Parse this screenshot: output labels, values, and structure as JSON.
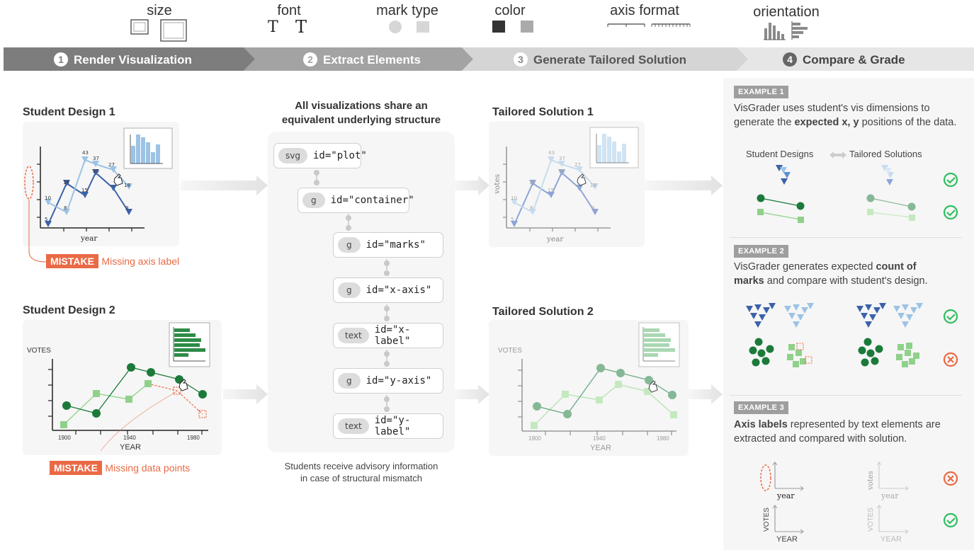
{
  "dimensions": {
    "size": "size",
    "font": "font",
    "font_glyph": "T",
    "mark_type": "mark type",
    "color": "color",
    "axis_format": "axis format",
    "orientation": "orientation"
  },
  "steps": [
    {
      "num": "1",
      "label": "Render Visualization"
    },
    {
      "num": "2",
      "label": "Extract Elements"
    },
    {
      "num": "3",
      "label": "Generate Tailored Solution"
    },
    {
      "num": "4",
      "label": "Compare & Grade"
    }
  ],
  "student1": {
    "title": "Student Design 1",
    "xlabel": "year",
    "data_labels": [
      "5",
      "10",
      "8",
      "19",
      "15",
      "43",
      "37",
      "25",
      "27",
      "18",
      "9"
    ],
    "mistake_tag": "MISTAKE",
    "mistake_text": "Missing axis label"
  },
  "student2": {
    "title": "Student Design 2",
    "ylabel": "VOTES",
    "xlabel": "YEAR",
    "ticks": [
      "1900",
      "1940",
      "1980"
    ],
    "mistake_tag": "MISTAKE",
    "mistake_text": "Missing data points"
  },
  "structure": {
    "title_line1": "All visualizations share an",
    "title_line2": "equivalent underlying  structure",
    "nodes": [
      {
        "tag": "svg",
        "id": "id=\"plot\""
      },
      {
        "tag": "g",
        "id": "id=\"container\""
      },
      {
        "tag": "g",
        "id": "id=\"marks\""
      },
      {
        "tag": "g",
        "id": "id=\"x-axis\""
      },
      {
        "tag": "text",
        "id": "id=\"x-label\""
      },
      {
        "tag": "g",
        "id": "id=\"y-axis\""
      },
      {
        "tag": "text",
        "id": "id=\"y-label\""
      }
    ],
    "footer_line1": "Students receive advisory information",
    "footer_line2": "in case of structural mismatch"
  },
  "solution1": {
    "title": "Tailored Solution 1",
    "ylabel": "votes",
    "xlabel": "year"
  },
  "solution2": {
    "title": "Tailored Solution  2",
    "ylabel": "VOTES",
    "xlabel": "YEAR",
    "ticks": [
      "1900",
      "1940",
      "1980"
    ]
  },
  "examples": [
    {
      "tag": "EXAMPLE 1",
      "line1": "VisGrader uses student's vis dimensions to",
      "line2_pre": "generate the ",
      "line2_bold": "expected x, y",
      "line2_post": " positions of the data.",
      "col_left": "Student Designs",
      "col_right": "Tailored Solutions"
    },
    {
      "tag": "EXAMPLE 2",
      "line1_pre": "VisGrader generates expected ",
      "line1_bold": "count of",
      "line2_bold": "marks",
      "line2_post": " and compare with student's design."
    },
    {
      "tag": "EXAMPLE 3",
      "line1_bold": "Axis labels",
      "line1_post": " represented by text elements are",
      "line2": "extracted and compared with solution.",
      "label_year": "year",
      "label_votes": "votes",
      "label_YEAR": "YEAR",
      "label_VOTES": "VOTES"
    }
  ],
  "colors": {
    "dark_blue": "#3b62a8",
    "mid_blue": "#5b8fcf",
    "light_blue": "#9cc3e5",
    "dark_green": "#1b7a3a",
    "light_green": "#8fd18a",
    "mistake": "#ea6a45",
    "check": "#2fbf5f"
  }
}
